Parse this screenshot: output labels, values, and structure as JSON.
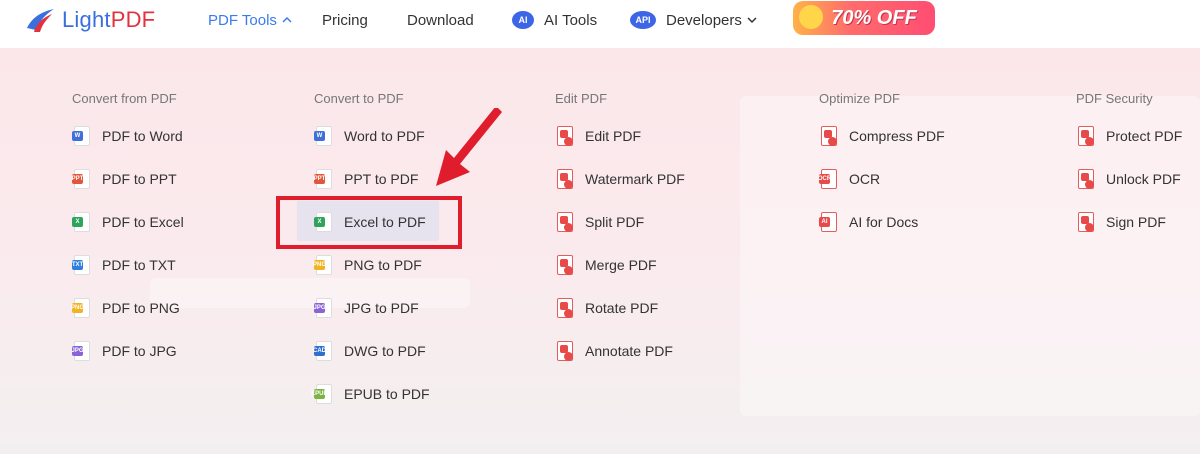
{
  "logo": {
    "text_a": "Light",
    "text_b": "PDF"
  },
  "nav": {
    "pdf_tools": "PDF Tools",
    "pricing": "Pricing",
    "download": "Download",
    "ai_badge": "AI",
    "ai_tools": "AI Tools",
    "api_badge": "API",
    "developers": "Developers"
  },
  "promo": {
    "text": "70% OFF"
  },
  "colors": {
    "accent": "#3a7bf0",
    "highlight_box": "#e01d2c",
    "pdf_red": "#e84a4a"
  },
  "columns": [
    {
      "title": "Convert from PDF",
      "items": [
        "PDF to Word",
        "PDF to PPT",
        "PDF to Excel",
        "PDF to TXT",
        "PDF to PNG",
        "PDF to JPG"
      ]
    },
    {
      "title": "Convert to PDF",
      "items": [
        "Word to PDF",
        "PPT to PDF",
        "Excel to PDF",
        "PNG to PDF",
        "JPG to PDF",
        "DWG to PDF",
        "EPUB to PDF"
      ]
    },
    {
      "title": "Edit PDF",
      "items": [
        "Edit PDF",
        "Watermark PDF",
        "Split PDF",
        "Merge PDF",
        "Rotate PDF",
        "Annotate PDF"
      ]
    },
    {
      "title": "Optimize PDF",
      "items": [
        "Compress PDF",
        "OCR",
        "AI for Docs"
      ]
    },
    {
      "title": "PDF Security",
      "items": [
        "Protect PDF",
        "Unlock PDF",
        "Sign PDF"
      ]
    }
  ],
  "icon_tags": {
    "word": "W",
    "ppt": "PPT",
    "excel": "X",
    "txt": "TXT",
    "png": "PNG",
    "jpg": "JPG",
    "dwg": "CAD",
    "epub": "EPUB",
    "ocr": "OCR",
    "ai": "AI"
  }
}
